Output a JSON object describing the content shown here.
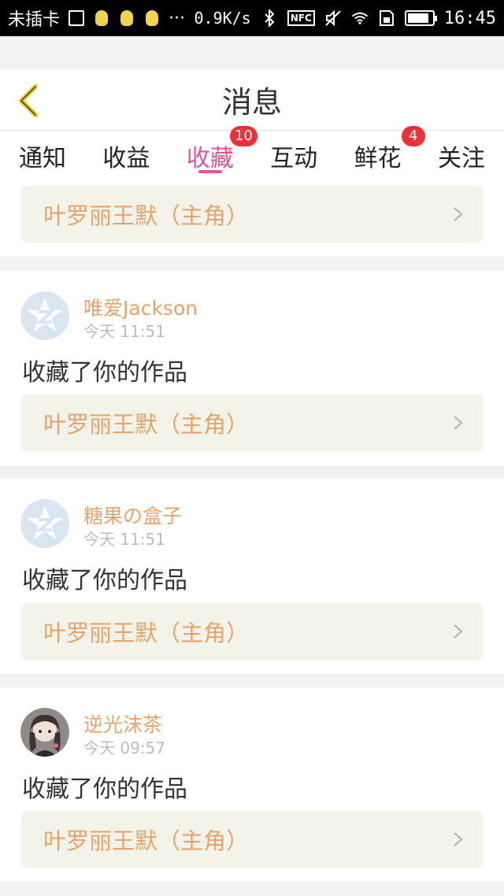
{
  "status_bar": {
    "carrier": "未插卡",
    "more": "···",
    "speed": "0.9K/s",
    "nfc": "NFC",
    "time": "16:45"
  },
  "header": {
    "title": "消息"
  },
  "tabs": [
    {
      "label": "通知",
      "badge": ""
    },
    {
      "label": "收益",
      "badge": ""
    },
    {
      "label": "收藏",
      "badge": "10",
      "active": true
    },
    {
      "label": "互动",
      "badge": ""
    },
    {
      "label": "鲜花",
      "badge": "4"
    },
    {
      "label": "关注",
      "badge": ""
    }
  ],
  "items": [
    {
      "user": "",
      "time": "",
      "action": "",
      "work_title": "叶罗丽王默（主角）"
    },
    {
      "user": "唯爱Jackson",
      "time": "今天 11:51",
      "action": "收藏了你的作品",
      "work_title": "叶罗丽王默（主角）"
    },
    {
      "user": "糖果の盒子",
      "time": "今天 11:51",
      "action": "收藏了你的作品",
      "work_title": "叶罗丽王默（主角）"
    },
    {
      "user": "逆光沫茶",
      "time": "今天 09:57",
      "action": "收藏了你的作品",
      "work_title": "叶罗丽王默（主角）"
    }
  ],
  "colors": {
    "accent": "#e0569a",
    "username": "#e8a36a",
    "badge": "#ee3039",
    "card_link_bg": "#f3f3ea"
  },
  "icons": {
    "back": "chevron-left-icon",
    "avatar_default": "qzone-z-avatar-icon",
    "chevron": "chevron-right-icon"
  }
}
